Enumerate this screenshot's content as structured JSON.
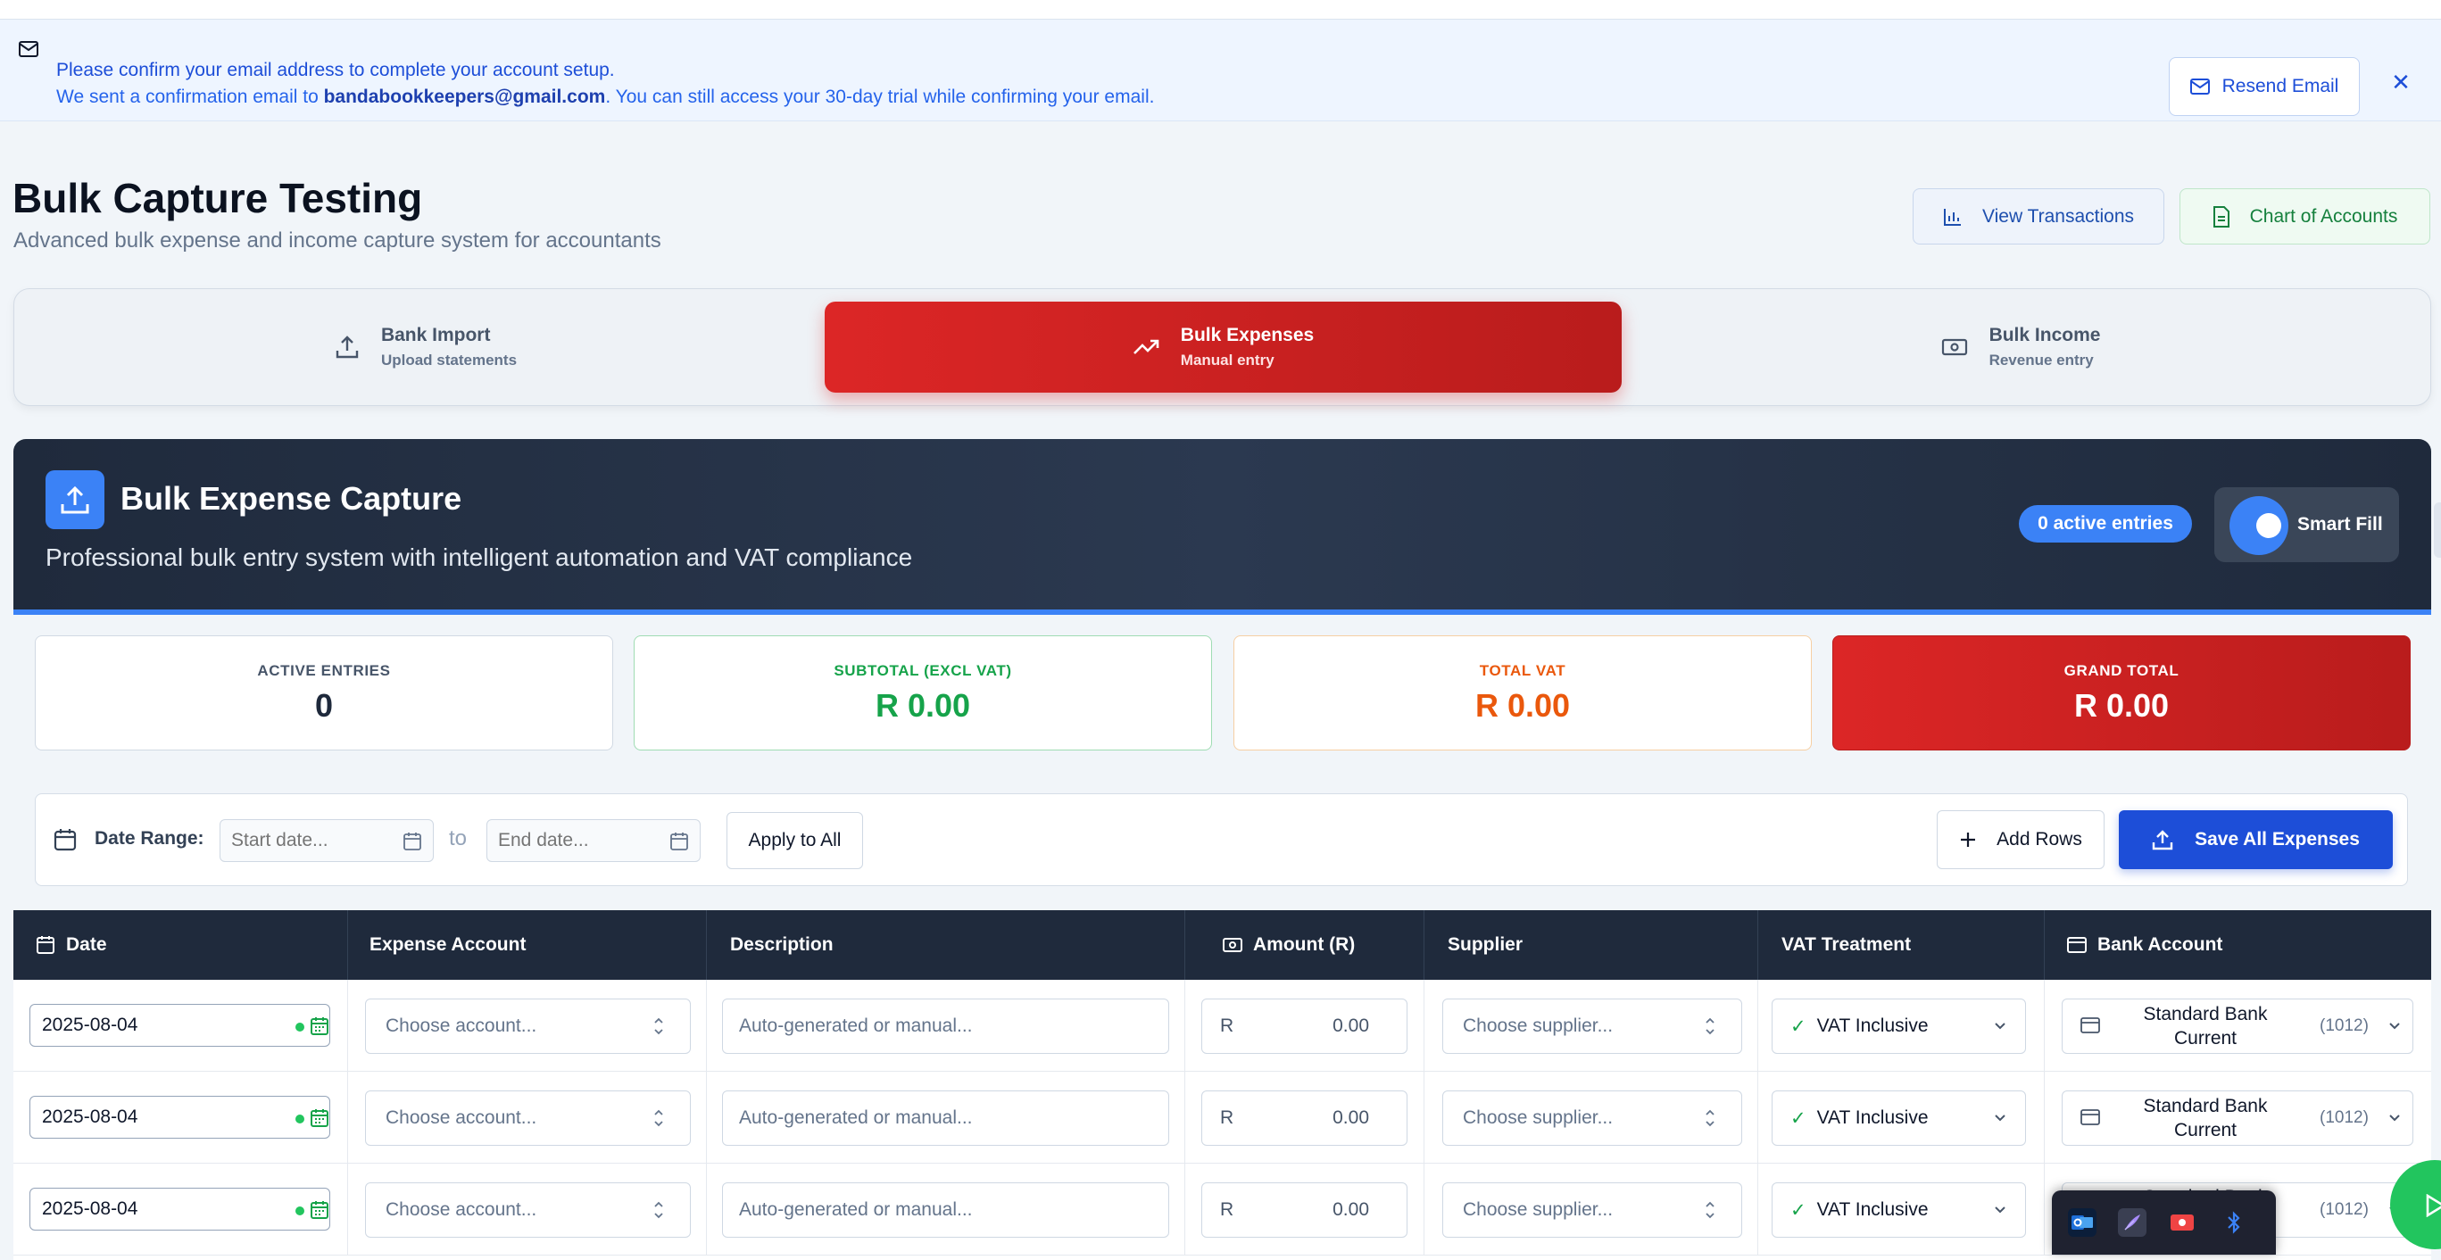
{
  "banner": {
    "line1": "Please confirm your email address to complete your account setup.",
    "line2_prefix": "We sent a confirmation email to ",
    "email": "bandabookkeepers@gmail.com",
    "line2_suffix": ". You can still access your 30-day trial while confirming your email.",
    "resend_label": "Resend Email",
    "close_symbol": "✕"
  },
  "header": {
    "title": "Bulk Capture Testing",
    "subtitle": "Advanced bulk expense and income capture system for accountants",
    "view_transactions_label": "View Transactions",
    "chart_of_accounts_label": "Chart of Accounts"
  },
  "tabs": [
    {
      "title": "Bank Import",
      "subtitle": "Upload statements",
      "icon": "upload-icon",
      "active": false
    },
    {
      "title": "Bulk Expenses",
      "subtitle": "Manual entry",
      "icon": "trending-up-icon",
      "active": true
    },
    {
      "title": "Bulk Income",
      "subtitle": "Revenue entry",
      "icon": "banknote-icon",
      "active": false
    }
  ],
  "capture": {
    "title": "Bulk Expense Capture",
    "subtitle": "Professional bulk entry system with intelligent automation and VAT compliance",
    "active_entries_pill": "0 active entries",
    "smart_fill_label": "Smart Fill",
    "smart_fill_on": true
  },
  "stats": [
    {
      "label": "ACTIVE ENTRIES",
      "value": "0"
    },
    {
      "label": "SUBTOTAL (EXCL VAT)",
      "value": "R 0.00"
    },
    {
      "label": "TOTAL VAT",
      "value": "R 0.00"
    },
    {
      "label": "GRAND TOTAL",
      "value": "R 0.00"
    }
  ],
  "toolbar": {
    "date_range_label": "Date Range:",
    "start_placeholder": "Start date...",
    "to_label": "to",
    "end_placeholder": "End date...",
    "apply_label": "Apply to All",
    "add_rows_label": "Add Rows",
    "save_all_label": "Save All Expenses"
  },
  "table": {
    "columns": [
      "Date",
      "Expense Account",
      "Description",
      "Amount (R)",
      "Supplier",
      "VAT Treatment",
      "Bank Account"
    ],
    "rows": [
      {
        "date": "2025-08-04",
        "account_placeholder": "Choose account...",
        "description_placeholder": "Auto-generated or manual...",
        "currency": "R",
        "amount": "0.00",
        "supplier_placeholder": "Choose supplier...",
        "vat": "VAT Inclusive",
        "bank_name": "Standard Bank Current",
        "bank_code": "(1012)"
      },
      {
        "date": "2025-08-04",
        "account_placeholder": "Choose account...",
        "description_placeholder": "Auto-generated or manual...",
        "currency": "R",
        "amount": "0.00",
        "supplier_placeholder": "Choose supplier...",
        "vat": "VAT Inclusive",
        "bank_name": "Standard Bank Current",
        "bank_code": "(1012)"
      },
      {
        "date": "2025-08-04",
        "account_placeholder": "Choose account...",
        "description_placeholder": "Auto-generated or manual...",
        "currency": "R",
        "amount": "0.00",
        "supplier_placeholder": "Choose supplier...",
        "vat": "VAT Inclusive",
        "bank_name": "Standard Bank",
        "bank_code": "(1012)"
      }
    ]
  },
  "colors": {
    "accent_red": "#dc2626",
    "accent_blue": "#1d4ed8",
    "header_dark": "#1f2a3c",
    "success_green": "#16a34a",
    "warning_orange": "#ea580c"
  }
}
